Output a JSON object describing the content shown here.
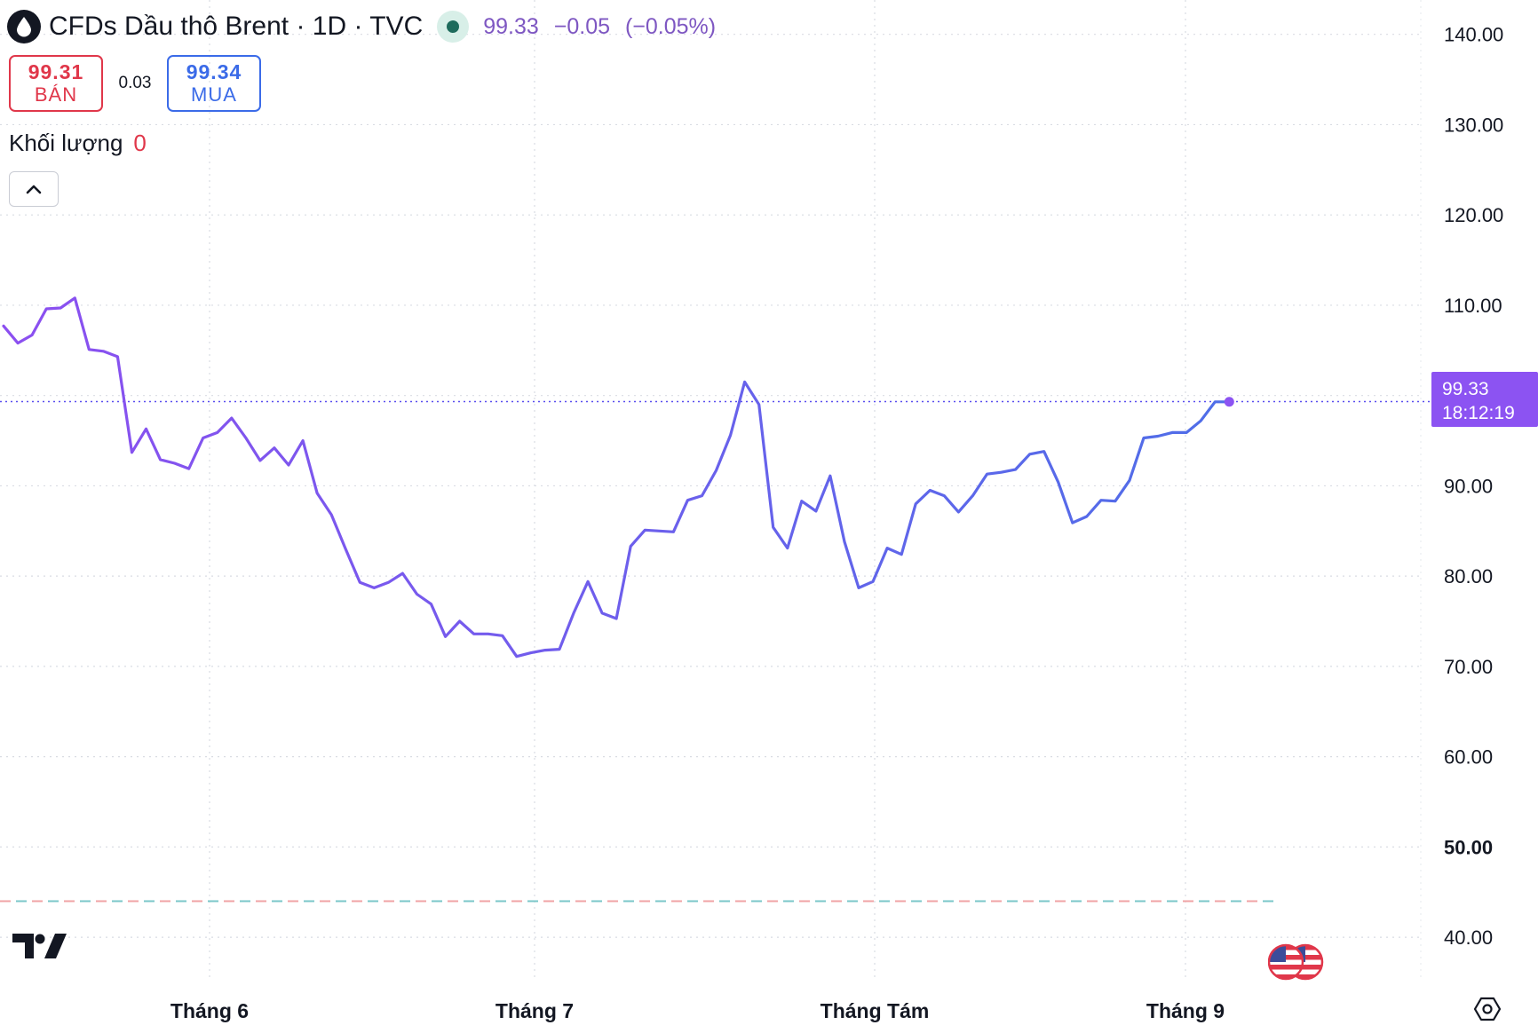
{
  "header": {
    "title": "CFDs Dầu thô Brent · 1D · TVC",
    "last": "99.33",
    "change": "−0.05",
    "change_pct": "(−0.05%)"
  },
  "trade": {
    "sell_price": "99.31",
    "sell_label": "BÁN",
    "spread": "0.03",
    "buy_price": "99.34",
    "buy_label": "MUA"
  },
  "volume": {
    "label": "Khối lượng",
    "value": "0"
  },
  "price_tag": {
    "price": "99.33",
    "countdown": "18:12:19"
  },
  "icons": {
    "symbol": "oil-drop-icon",
    "collapse": "chevron-up-icon",
    "logo": "tradingview-logo-icon",
    "flag": "us-flag-icon",
    "settings": "settings-icon"
  },
  "colors": {
    "line_start": "#8c4ff0",
    "line_end": "#4f6ee8",
    "sell": "#e0374a",
    "buy": "#3b6be8",
    "price_tag": "#8c53f2"
  },
  "chart_data": {
    "type": "line",
    "title": "",
    "xlabel": "",
    "ylabel": "",
    "y_ticks": [
      "140.00",
      "130.00",
      "120.00",
      "110.00",
      "100.00",
      "90.00",
      "80.00",
      "70.00",
      "60.00",
      "50.00",
      "40.00"
    ],
    "ylim": [
      35.2,
      143.8
    ],
    "x_ticks": [
      "Tháng 6",
      "Tháng 7",
      "Tháng Tám",
      "Tháng 9"
    ],
    "grid": true,
    "current_price_line": 99.33,
    "horizontal_dashed_line": 44.0,
    "series": [
      {
        "values": [
          107.7,
          105.8,
          106.7,
          109.6,
          109.7,
          110.8,
          105.1,
          104.9,
          104.3,
          93.7,
          96.3,
          92.9,
          92.5,
          91.9,
          95.3,
          95.9,
          97.5,
          95.3,
          92.8,
          94.2,
          92.3,
          95.0,
          89.2,
          86.8,
          83.0,
          79.3,
          78.7,
          79.3,
          80.3,
          78.0,
          76.9,
          73.3,
          75.0,
          73.6,
          73.6,
          73.4,
          71.1,
          71.5,
          71.8,
          71.9,
          75.9,
          79.4,
          75.9,
          75.3,
          83.3,
          85.1,
          85.0,
          84.9,
          88.4,
          88.9,
          91.7,
          95.6,
          101.5,
          99.0,
          85.4,
          83.1,
          88.3,
          87.2,
          91.1,
          83.8,
          78.7,
          79.4,
          83.1,
          82.4,
          88.0,
          89.5,
          88.9,
          87.1,
          88.9,
          91.3,
          91.5,
          91.8,
          93.5,
          93.8,
          90.4,
          85.9,
          86.6,
          88.4,
          88.3,
          90.6,
          95.3,
          95.5,
          95.9,
          95.9,
          97.2,
          99.3,
          99.3
        ]
      }
    ]
  }
}
